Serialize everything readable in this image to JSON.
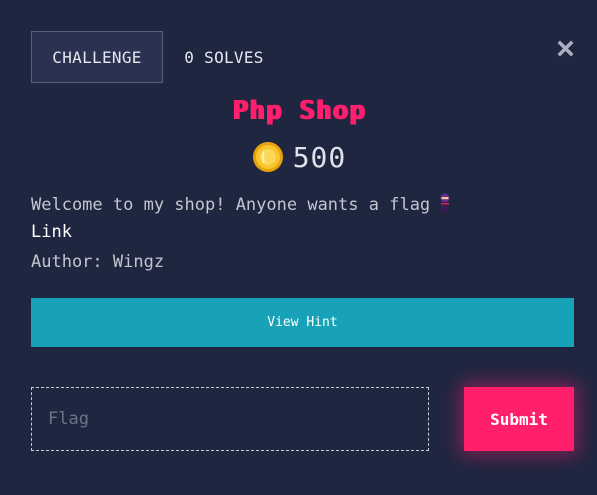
{
  "header": {
    "tab_challenge": "CHALLENGE",
    "tab_solves": "0 SOLVES",
    "close_icon": "close-x-icon"
  },
  "challenge": {
    "title": "Php Shop",
    "points": "500",
    "coin_icon": "coin-icon",
    "description": "Welcome to my shop! Anyone wants a flag",
    "description_emoji": "ninja-icon",
    "link_label": "Link",
    "author": "Author: Wingz"
  },
  "hint": {
    "button_label": "View Hint"
  },
  "submission": {
    "placeholder": "Flag",
    "value": "",
    "submit_label": "Submit"
  },
  "colors": {
    "background": "#1f2640",
    "accent_pink": "#ff1f6d",
    "hint_teal": "#17a2b8"
  }
}
